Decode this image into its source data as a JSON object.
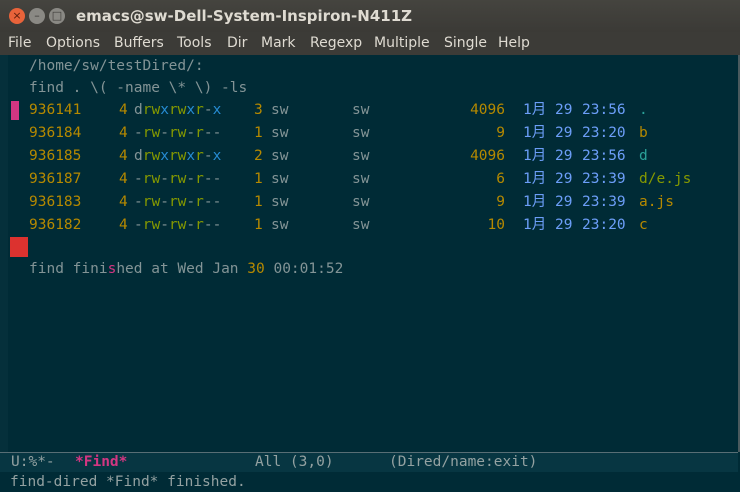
{
  "window": {
    "title": "emacs@sw-Dell-System-Inspiron-N411Z",
    "close": "×",
    "minimize": "–",
    "maximize": "□"
  },
  "menu": [
    "File",
    "Options",
    "Buffers",
    "Tools",
    "Dir",
    "Mark",
    "Regexp",
    "Multiple",
    "Single",
    "Help"
  ],
  "buffer": {
    "dir": "/home/sw/testDired/:",
    "command": "find . \\( -name \\* \\) -ls",
    "rows": [
      {
        "inode": "936141",
        "blocks": "4",
        "perm": [
          "d",
          "rwx",
          "rwx",
          "r-x"
        ],
        "links": "3",
        "owner": "sw",
        "group": "sw",
        "size": "4096",
        "month": "1月",
        "day": "29",
        "time": "23:56",
        "name": ".",
        "kind": "dir"
      },
      {
        "inode": "936184",
        "blocks": "4",
        "perm": [
          "-",
          "rw-",
          "rw-",
          "r--"
        ],
        "links": "1",
        "owner": "sw",
        "group": "sw",
        "size": "9",
        "month": "1月",
        "day": "29",
        "time": "23:20",
        "name": "b",
        "kind": "file"
      },
      {
        "inode": "936185",
        "blocks": "4",
        "perm": [
          "d",
          "rwx",
          "rwx",
          "r-x"
        ],
        "links": "2",
        "owner": "sw",
        "group": "sw",
        "size": "4096",
        "month": "1月",
        "day": "29",
        "time": "23:56",
        "name": "d",
        "kind": "dir"
      },
      {
        "inode": "936187",
        "blocks": "4",
        "perm": [
          "-",
          "rw-",
          "rw-",
          "r--"
        ],
        "links": "1",
        "owner": "sw",
        "group": "sw",
        "size": "6",
        "month": "1月",
        "day": "29",
        "time": "23:39",
        "name": "d/e.js",
        "kind": "js"
      },
      {
        "inode": "936183",
        "blocks": "4",
        "perm": [
          "-",
          "rw-",
          "rw-",
          "r--"
        ],
        "links": "1",
        "owner": "sw",
        "group": "sw",
        "size": "9",
        "month": "1月",
        "day": "29",
        "time": "23:39",
        "name": "a.js",
        "kind": "file"
      },
      {
        "inode": "936182",
        "blocks": "4",
        "perm": [
          "-",
          "rw-",
          "rw-",
          "r--"
        ],
        "links": "1",
        "owner": "sw",
        "group": "sw",
        "size": "10",
        "month": "1月",
        "day": "29",
        "time": "23:20",
        "name": "c",
        "kind": "file"
      }
    ],
    "finished": {
      "a": "find fini",
      "b": "s",
      "c": "hed at Wed Jan ",
      "d": "30",
      "e": " 00:01:52"
    }
  },
  "modeline": {
    "status": "U:%*-",
    "buffer": "*Find*",
    "position": "All (3,0)",
    "mode": "(Dired/name:exit)"
  },
  "echo": "find-dired *Find* finished."
}
